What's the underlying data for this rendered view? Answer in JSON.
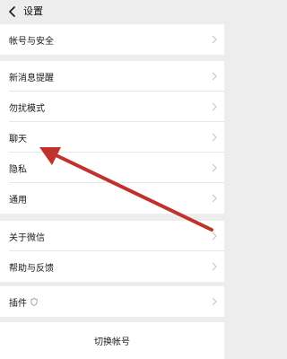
{
  "header": {
    "title": "设置",
    "back_icon": "back-arrow-icon"
  },
  "groups": [
    {
      "items": [
        {
          "label": "帐号与安全"
        }
      ]
    },
    {
      "items": [
        {
          "label": "新消息提醒"
        },
        {
          "label": "勿扰模式"
        },
        {
          "label": "聊天"
        },
        {
          "label": "隐私"
        },
        {
          "label": "通用"
        }
      ]
    },
    {
      "items": [
        {
          "label": "关于微信"
        },
        {
          "label": "帮助与反馈"
        }
      ]
    },
    {
      "items": [
        {
          "label": "插件"
        }
      ]
    }
  ],
  "switch_account": {
    "label": "切换帐号"
  },
  "annotation": {
    "arrow_color": "#c0322b",
    "points_to": "隐私"
  },
  "colors": {
    "background": "#ededed",
    "card": "#ffffff",
    "chevron": "#c8c8c8"
  }
}
